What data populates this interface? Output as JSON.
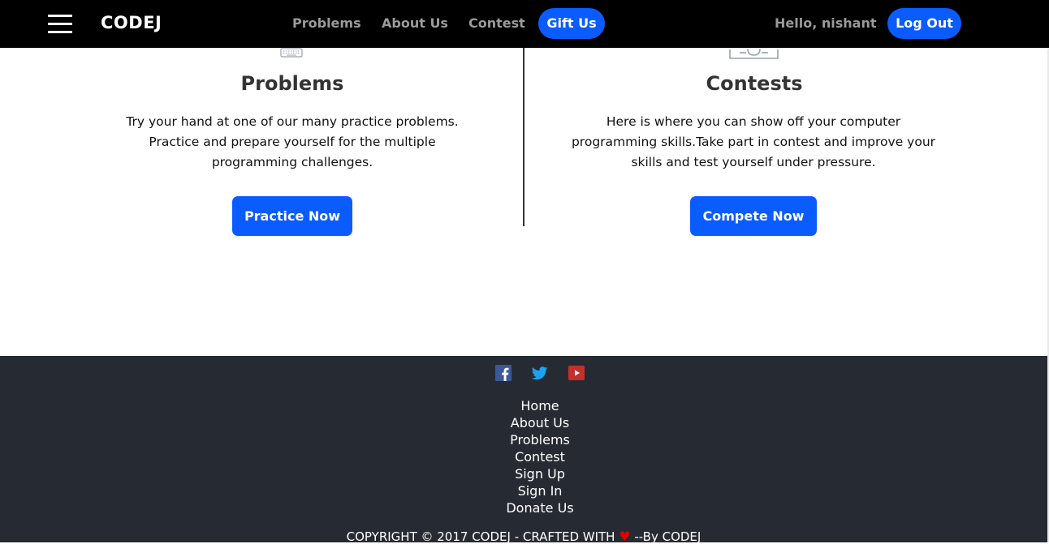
{
  "navbar": {
    "brand": "CODEJ",
    "links": [
      "Problems",
      "About Us",
      "Contest"
    ],
    "gift_label": "Gift Us",
    "greeting": "Hello, nishant",
    "logout_label": "Log Out"
  },
  "features": {
    "problems": {
      "title": "Problems",
      "lines": [
        "Try your hand at one of our many practice problems.",
        "Practice and prepare yourself for the multiple",
        "programming challenges."
      ],
      "button": "Practice Now"
    },
    "contests": {
      "title": "Contests",
      "lines": [
        "Here is where you can show off your computer",
        "programming skills.Take part in contest and improve your",
        "skills and test yourself under pressure."
      ],
      "button": "Compete Now"
    }
  },
  "footer": {
    "social_icons": [
      "facebook-icon",
      "twitter-icon",
      "youtube-icon"
    ],
    "links": [
      "Home",
      "About Us",
      "Problems",
      "Contest",
      "Sign Up",
      "Sign In",
      "Donate Us"
    ],
    "copyright_prefix": "COPYRIGHT © 2017 CODEJ - CRAFTED WITH",
    "copyright_suffix": "--By CODEJ"
  },
  "colors": {
    "navbar_bg": "#000000",
    "accent": "#0a5cff",
    "footer_bg": "#262b33",
    "heart": "#e00000"
  }
}
